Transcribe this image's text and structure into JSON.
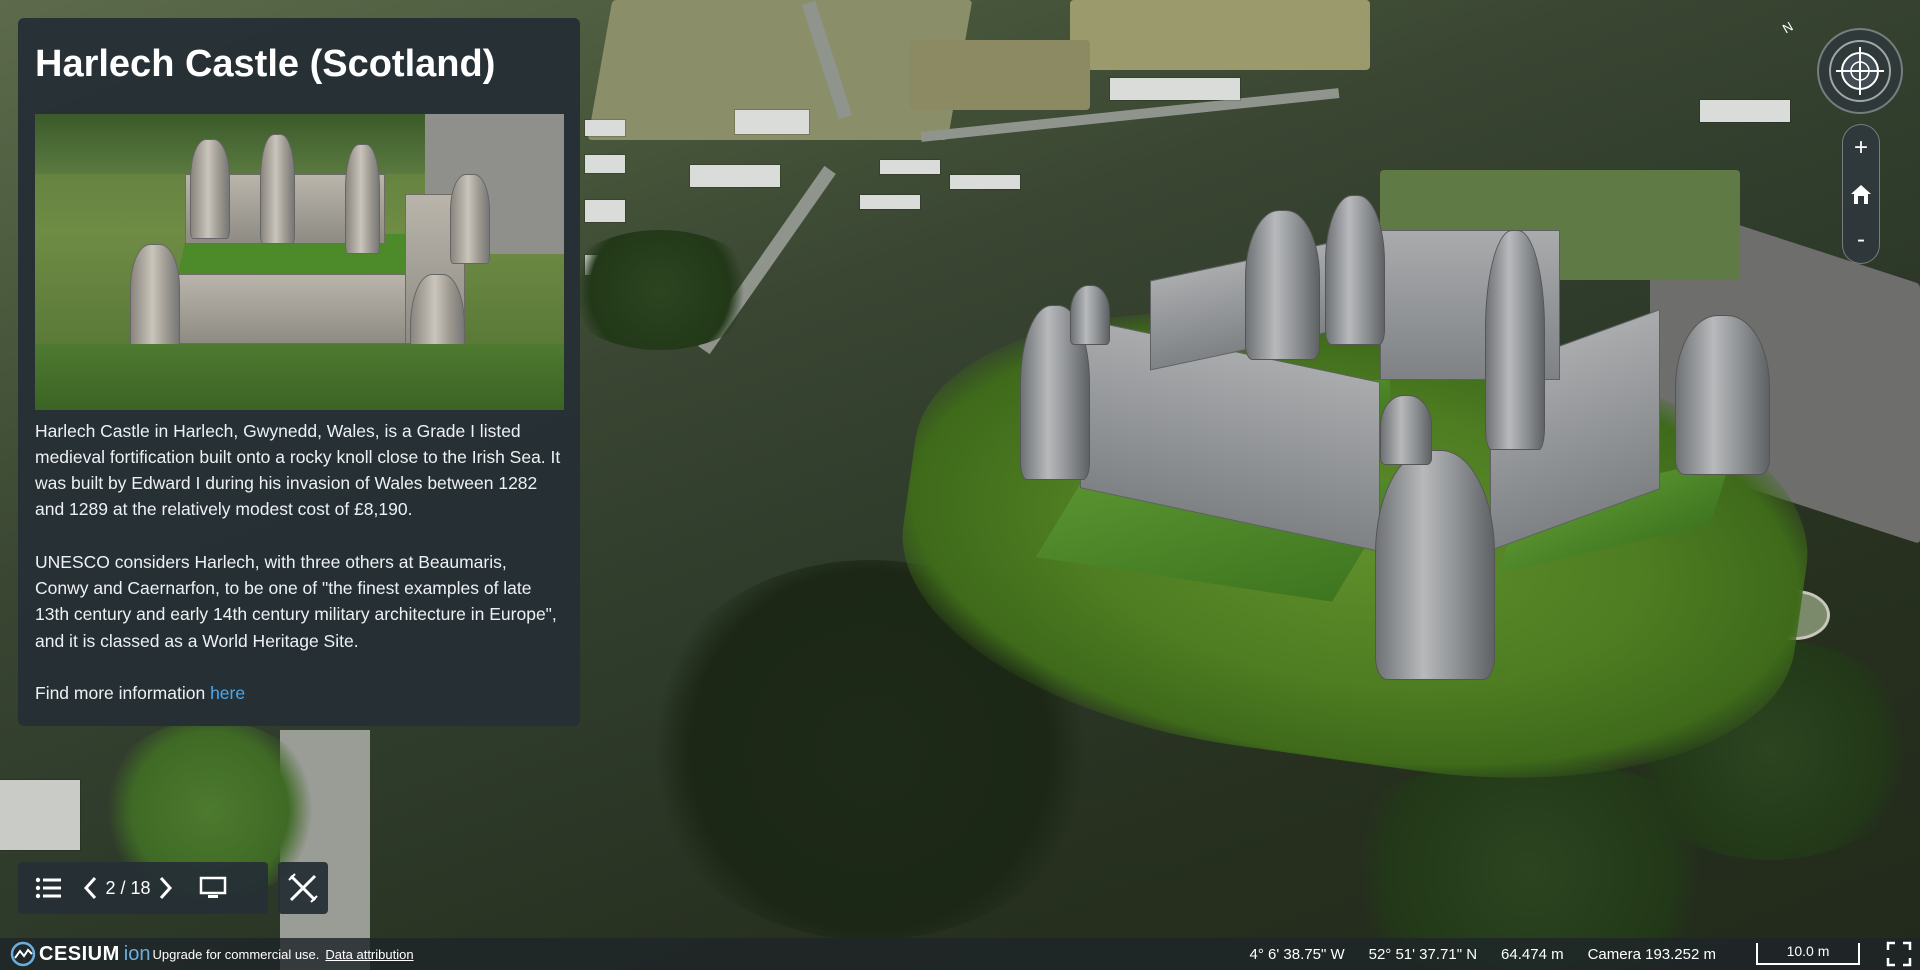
{
  "info_panel": {
    "title": "Harlech Castle (Scotland)",
    "paragraph_1": "Harlech Castle in Harlech, Gwynedd, Wales, is a Grade I listed medieval fortification built onto a rocky knoll close to the Irish Sea. It was built by Edward I during his invasion of Wales between 1282 and 1289 at the relatively modest cost of £8,190.",
    "paragraph_2": "UNESCO considers Harlech, with three others at Beaumaris, Conwy and Caernarfon, to be one of \"the finest examples of late 13th century and early 14th century military architecture in Europe\", and it is classed as a World Heritage Site.",
    "more_info_text": "Find more information ",
    "more_info_link": "here"
  },
  "toolbar": {
    "list_icon": "list-icon",
    "prev_icon": "chevron-left-icon",
    "counter": "2 / 18",
    "next_icon": "chevron-right-icon",
    "present_icon": "monitor-icon",
    "close_icon": "close-icon"
  },
  "navigation": {
    "compass_north": "N",
    "zoom_in": "+",
    "zoom_out": "-",
    "home_icon": "home-icon"
  },
  "status_bar": {
    "logo_text": "CESIUM",
    "logo_ion": "ion",
    "upgrade_text": "Upgrade for commercial use.",
    "attribution_link": "Data attribution",
    "longitude": "4° 6' 38.75\" W",
    "latitude": "52° 51' 37.71\" N",
    "elevation": "64.474 m",
    "camera": "Camera 193.252 m",
    "scale": "10.0 m",
    "fullscreen_icon": "fullscreen-icon"
  },
  "colors": {
    "panel_bg": "#262f35",
    "link": "#4fa6e8",
    "ion_blue": "#6cadde"
  }
}
